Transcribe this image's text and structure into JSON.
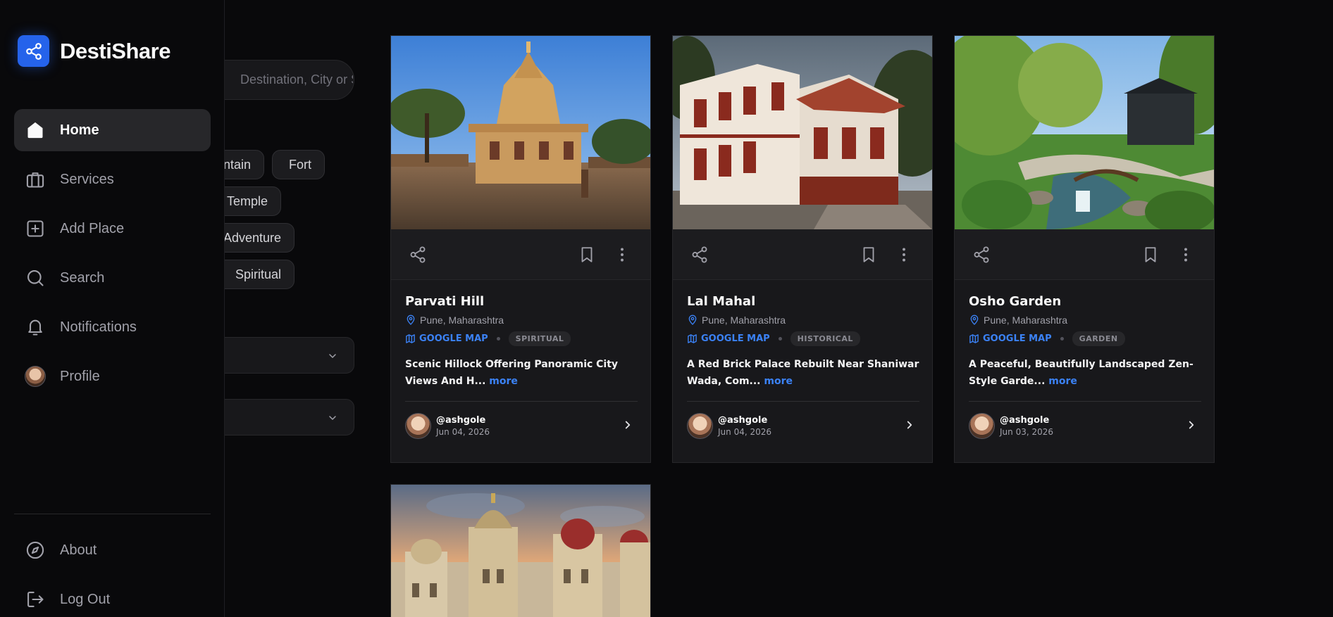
{
  "brand": {
    "name": "DestiShare"
  },
  "nav": {
    "items": [
      {
        "label": "Home",
        "icon": "home-icon",
        "active": true
      },
      {
        "label": "Services",
        "icon": "briefcase-icon"
      },
      {
        "label": "Add Place",
        "icon": "plus-square-icon"
      },
      {
        "label": "Search",
        "icon": "search-icon"
      },
      {
        "label": "Notifications",
        "icon": "bell-icon"
      },
      {
        "label": "Profile",
        "icon": "avatar"
      }
    ],
    "bottom": [
      {
        "label": "About",
        "icon": "compass-icon"
      },
      {
        "label": "Log Out",
        "icon": "logout-icon"
      }
    ]
  },
  "filters": {
    "search_placeholder": "Destination, City or State",
    "chips": [
      "Mountain",
      "Fort",
      "Temple",
      "Adventure",
      "Spiritual"
    ]
  },
  "cards": [
    {
      "title": "Parvati Hill",
      "location": "Pune, Maharashtra",
      "map_label": "GOOGLE MAP",
      "category": "SPIRITUAL",
      "desc": "Scenic Hillock Offering Panoramic City Views And H...",
      "more": "more",
      "author": "@ashgole",
      "date": "Jun 04, 2026"
    },
    {
      "title": "Lal Mahal",
      "location": "Pune, Maharashtra",
      "map_label": "GOOGLE MAP",
      "category": "HISTORICAL",
      "desc": "A Red Brick Palace Rebuilt Near Shaniwar Wada, Com...",
      "more": "more",
      "author": "@ashgole",
      "date": "Jun 04, 2026"
    },
    {
      "title": "Osho Garden",
      "location": "Pune, Maharashtra",
      "map_label": "GOOGLE MAP",
      "category": "GARDEN",
      "desc": "A Peaceful, Beautifully Landscaped Zen-Style Garde...",
      "more": "more",
      "author": "@ashgole",
      "date": "Jun 03, 2026"
    }
  ],
  "colors": {
    "accent": "#2563eb",
    "link": "#3b82f6",
    "background": "#09090b",
    "card": "#18181b"
  }
}
